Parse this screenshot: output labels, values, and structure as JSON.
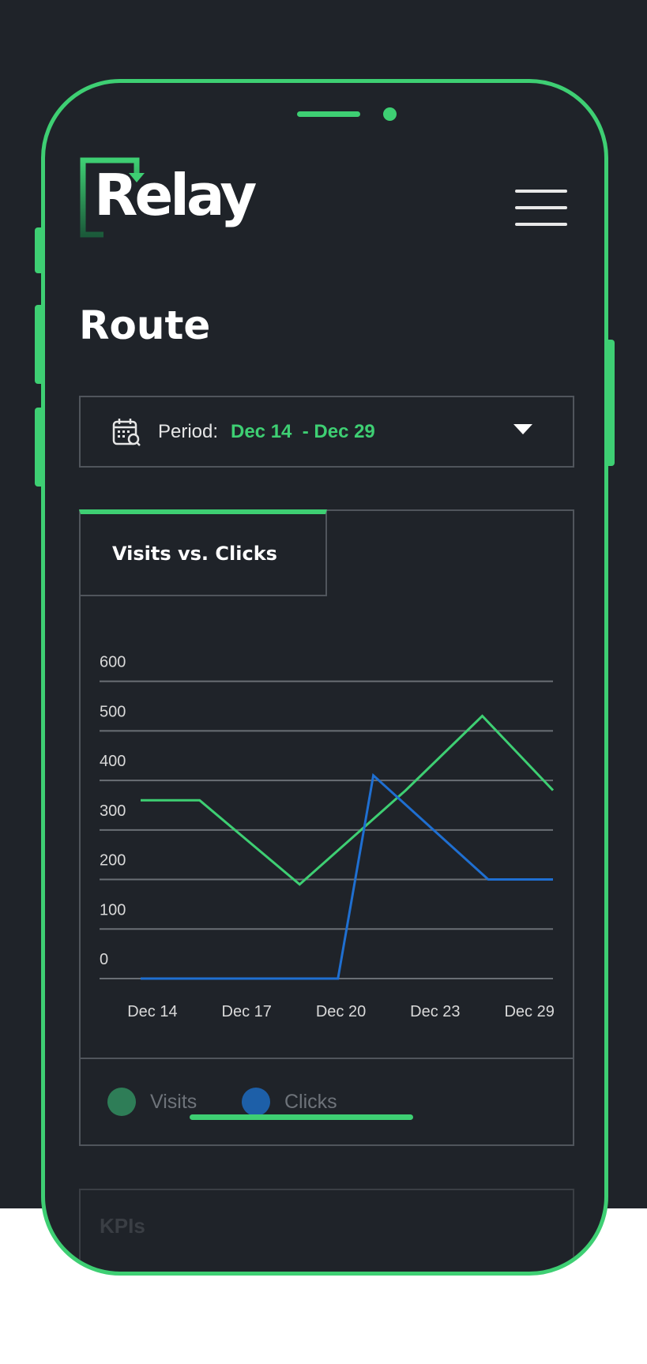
{
  "app": {
    "name": "Relay",
    "accent_color": "#3ecf73",
    "background_color": "#1f2329"
  },
  "header": {
    "logo_text": "Relay",
    "menu_icon": "hamburger-menu-icon"
  },
  "page": {
    "title": "Route"
  },
  "period": {
    "icon": "calendar-icon",
    "label": "Period:",
    "value": "Dec 14  - Dec 29",
    "dropdown_icon": "caret-down-icon"
  },
  "chart_card": {
    "tab_label": "Visits vs. Clicks"
  },
  "chart_data": {
    "type": "line",
    "title": "Visits vs. Clicks",
    "x": [
      0,
      1,
      2,
      3,
      4,
      5,
      6,
      7
    ],
    "x_tick_labels": [
      "Dec 14",
      "Dec 17",
      "Dec 20",
      "Dec 23",
      "Dec 29"
    ],
    "x_tick_positions": [
      0.2,
      1.8,
      3.4,
      5.0,
      6.6
    ],
    "y_tick_labels": [
      "600",
      "500",
      "400",
      "300",
      "200",
      "100",
      "0"
    ],
    "ylim": [
      -60,
      600
    ],
    "grid": true,
    "series": [
      {
        "name": "Visits",
        "color": "#3ecf73",
        "points": [
          [
            0,
            300
          ],
          [
            1,
            300
          ],
          [
            2.7,
            130
          ],
          [
            4.5,
            320
          ],
          [
            5.8,
            470
          ],
          [
            7,
            320
          ]
        ]
      },
      {
        "name": "Clicks",
        "color": "#1f6fd1",
        "points": [
          [
            0,
            -60
          ],
          [
            3.35,
            -60
          ],
          [
            3.95,
            350
          ],
          [
            5.9,
            140
          ],
          [
            7,
            140
          ]
        ]
      }
    ]
  },
  "legend": {
    "items": [
      {
        "label": "Visits",
        "color": "#2e7d57"
      },
      {
        "label": "Clicks",
        "color": "#1d5fa8"
      }
    ]
  },
  "kpis": {
    "label": "KPIs"
  }
}
